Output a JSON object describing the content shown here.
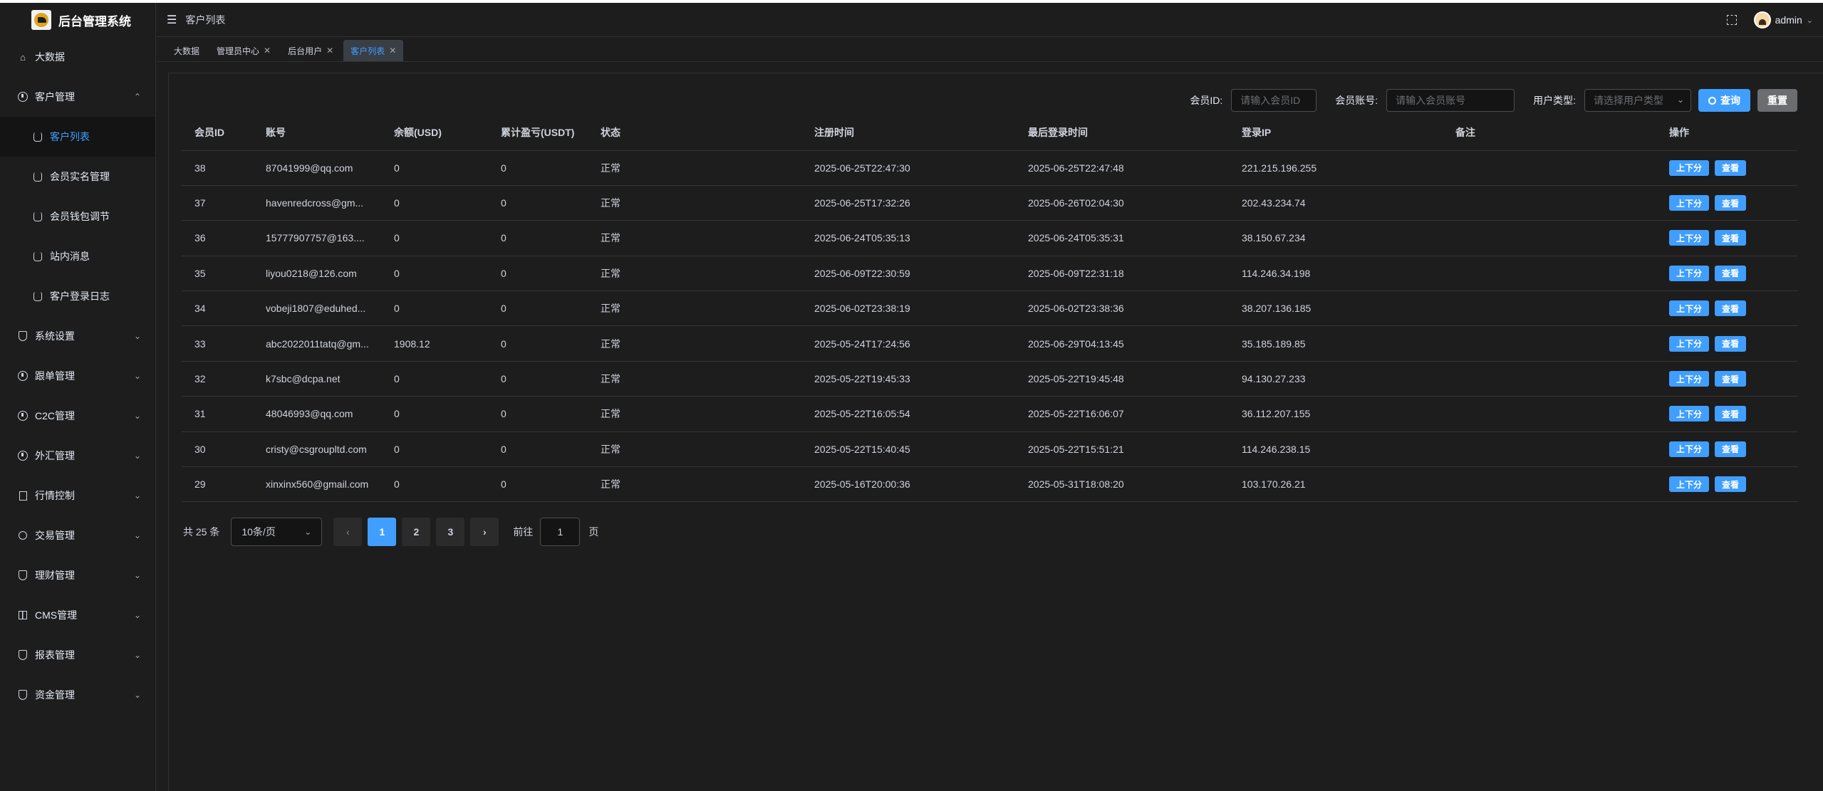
{
  "app": {
    "title": "后台管理系统"
  },
  "sidebar": {
    "items": [
      {
        "label": "大数据",
        "icon": "home-icon",
        "expandable": false
      },
      {
        "label": "客户管理",
        "icon": "alert-circle-icon",
        "expandable": true,
        "expanded": true
      }
    ],
    "subitems": [
      {
        "label": "客户列表",
        "active": true
      },
      {
        "label": "会员实名管理"
      },
      {
        "label": "会员钱包调节"
      },
      {
        "label": "站内消息"
      },
      {
        "label": "客户登录日志"
      }
    ],
    "groups": [
      {
        "label": "系统设置",
        "icon": "shield-icon"
      },
      {
        "label": "跟单管理",
        "icon": "alert-circle-icon"
      },
      {
        "label": "C2C管理",
        "icon": "alert-circle-icon"
      },
      {
        "label": "外汇管理",
        "icon": "alert-circle-icon"
      },
      {
        "label": "行情控制",
        "icon": "document-icon"
      },
      {
        "label": "交易管理",
        "icon": "alarm-icon"
      },
      {
        "label": "理财管理",
        "icon": "shield-icon"
      },
      {
        "label": "CMS管理",
        "icon": "grid-icon"
      },
      {
        "label": "报表管理",
        "icon": "shield-icon"
      },
      {
        "label": "资金管理",
        "icon": "shield-icon"
      }
    ]
  },
  "header": {
    "breadcrumb": "客户列表",
    "username": "admin"
  },
  "tabs": [
    {
      "label": "大数据",
      "closable": false,
      "active": false
    },
    {
      "label": "管理员中心",
      "closable": true,
      "active": false
    },
    {
      "label": "后台用户",
      "closable": true,
      "active": false
    },
    {
      "label": "客户列表",
      "closable": true,
      "active": true
    }
  ],
  "search": {
    "member_id_label": "会员ID:",
    "member_id_placeholder": "请输入会员ID",
    "account_label": "会员账号:",
    "account_placeholder": "请输入会员账号",
    "user_type_label": "用户类型:",
    "user_type_placeholder": "请选择用户类型",
    "query_label": "查询",
    "reset_label": "重置"
  },
  "table": {
    "columns": [
      "会员ID",
      "账号",
      "余额(USD)",
      "累计盈亏(USDT)",
      "状态",
      "注册时间",
      "最后登录时间",
      "登录IP",
      "备注",
      "操作"
    ],
    "op_labels": [
      "上下分",
      "查看"
    ],
    "rows": [
      {
        "id": "38",
        "account": "87041999@qq.com",
        "balance": "0",
        "pnl": "0",
        "status": "正常",
        "reg": "2025-06-25T22:47:30",
        "last": "2025-06-25T22:47:48",
        "ip": "221.215.196.255",
        "note": ""
      },
      {
        "id": "37",
        "account": "havenredcross@gm...",
        "balance": "0",
        "pnl": "0",
        "status": "正常",
        "reg": "2025-06-25T17:32:26",
        "last": "2025-06-26T02:04:30",
        "ip": "202.43.234.74",
        "note": ""
      },
      {
        "id": "36",
        "account": "15777907757@163....",
        "balance": "0",
        "pnl": "0",
        "status": "正常",
        "reg": "2025-06-24T05:35:13",
        "last": "2025-06-24T05:35:31",
        "ip": "38.150.67.234",
        "note": ""
      },
      {
        "id": "35",
        "account": "liyou0218@126.com",
        "balance": "0",
        "pnl": "0",
        "status": "正常",
        "reg": "2025-06-09T22:30:59",
        "last": "2025-06-09T22:31:18",
        "ip": "114.246.34.198",
        "note": ""
      },
      {
        "id": "34",
        "account": "vobeji1807@eduhed...",
        "balance": "0",
        "pnl": "0",
        "status": "正常",
        "reg": "2025-06-02T23:38:19",
        "last": "2025-06-02T23:38:36",
        "ip": "38.207.136.185",
        "note": ""
      },
      {
        "id": "33",
        "account": "abc2022011tatq@gm...",
        "balance": "1908.12",
        "pnl": "0",
        "status": "正常",
        "reg": "2025-05-24T17:24:56",
        "last": "2025-06-29T04:13:45",
        "ip": "35.185.189.85",
        "note": ""
      },
      {
        "id": "32",
        "account": "k7sbc@dcpa.net",
        "balance": "0",
        "pnl": "0",
        "status": "正常",
        "reg": "2025-05-22T19:45:33",
        "last": "2025-05-22T19:45:48",
        "ip": "94.130.27.233",
        "note": ""
      },
      {
        "id": "31",
        "account": "48046993@qq.com",
        "balance": "0",
        "pnl": "0",
        "status": "正常",
        "reg": "2025-05-22T16:05:54",
        "last": "2025-05-22T16:06:07",
        "ip": "36.112.207.155",
        "note": ""
      },
      {
        "id": "30",
        "account": "cristy@csgroupltd.com",
        "balance": "0",
        "pnl": "0",
        "status": "正常",
        "reg": "2025-05-22T15:40:45",
        "last": "2025-05-22T15:51:21",
        "ip": "114.246.238.15",
        "note": ""
      },
      {
        "id": "29",
        "account": "xinxinx560@gmail.com",
        "balance": "0",
        "pnl": "0",
        "status": "正常",
        "reg": "2025-05-16T20:00:36",
        "last": "2025-05-31T18:08:20",
        "ip": "103.170.26.21",
        "note": ""
      }
    ]
  },
  "pagination": {
    "total_text": "共 25 条",
    "page_size": "10条/页",
    "pages": [
      "1",
      "2",
      "3"
    ],
    "current": "1",
    "goto_label": "前往",
    "goto_value": "1",
    "page_suffix": "页"
  },
  "colors": {
    "accent": "#409eff",
    "background": "#1d1d1d",
    "reset_button": "#6b6d71"
  }
}
